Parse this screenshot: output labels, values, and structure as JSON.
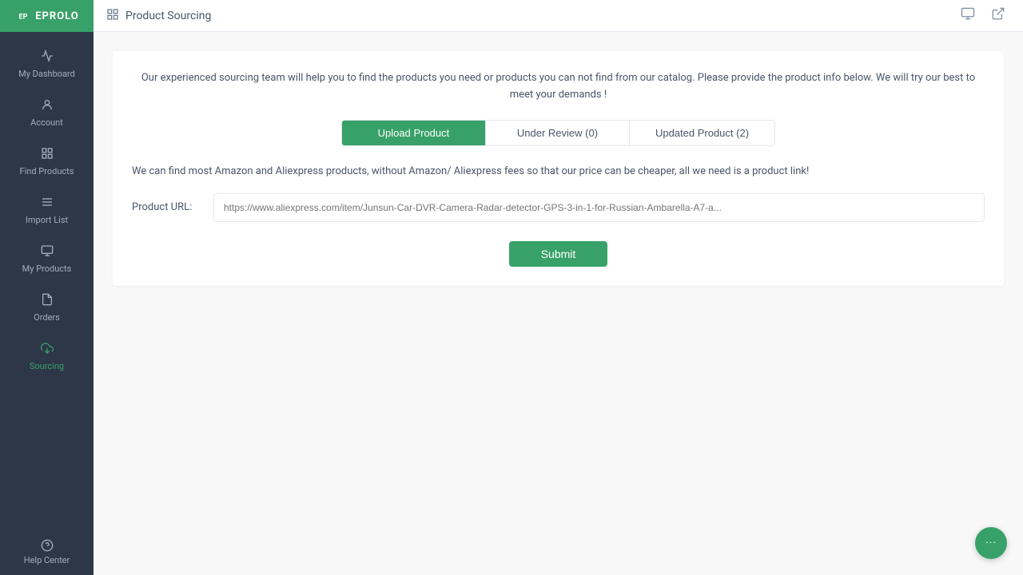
{
  "app": {
    "logo_text": "EPROLO",
    "logo_icon": "E"
  },
  "sidebar": {
    "items": [
      {
        "id": "dashboard",
        "label": "My Dashboard",
        "icon": "📊"
      },
      {
        "id": "account",
        "label": "Account",
        "icon": "👤"
      },
      {
        "id": "find-products",
        "label": "Find Products",
        "icon": "⊞"
      },
      {
        "id": "import-list",
        "label": "Import List",
        "icon": "☰"
      },
      {
        "id": "my-products",
        "label": "My Products",
        "icon": "📦"
      },
      {
        "id": "orders",
        "label": "Orders",
        "icon": "📋"
      },
      {
        "id": "sourcing",
        "label": "Sourcing",
        "icon": "⬇"
      }
    ],
    "help": {
      "icon": "ℹ",
      "label": "Help Center"
    }
  },
  "header": {
    "icon": "⊞",
    "title": "Product Sourcing",
    "action1_icon": "🖥",
    "action2_icon": "↗"
  },
  "main": {
    "description": "Our experienced sourcing team will help you to find the products you need or products you can not find from our catalog. Please provide the product info below. We will try our best to meet your demands !",
    "tabs": [
      {
        "id": "upload",
        "label": "Upload Product",
        "active": true
      },
      {
        "id": "under-review",
        "label": "Under Review (0)",
        "active": false
      },
      {
        "id": "updated-product",
        "label": "Updated Product (2)",
        "active": false
      }
    ],
    "info_text": "We can find most Amazon and Aliexpress products, without Amazon/ Aliexpress fees so that our price can be cheaper, all we need is a product link!",
    "product_url_label": "Product URL:",
    "product_url_placeholder": "https://www.aliexpress.com/item/Junsun-Car-DVR-Camera-Radar-detector-GPS-3-in-1-for-Russian-Ambarella-A7-a...",
    "submit_label": "Submit"
  },
  "chat": {
    "icon": "···"
  }
}
